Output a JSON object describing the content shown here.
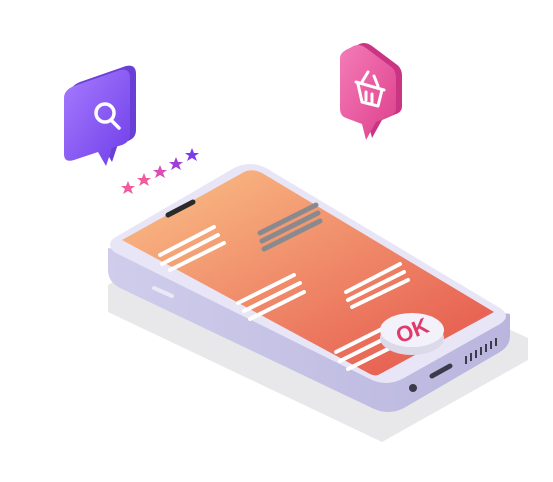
{
  "illustration": {
    "ok_button_label": "OK",
    "rating_stars": 5,
    "icons": {
      "search_bubble": "magnifier-icon",
      "shop_bubble": "basket-icon"
    },
    "colors": {
      "screen_gradient_start": "#fbc288",
      "screen_gradient_end": "#e4524a",
      "phone_body": "#c9c6e6",
      "phone_frame": "#e6e4f5",
      "search_bubble": "#8b5cf6",
      "shop_bubble": "#ec5ba3",
      "star_pink": "#f25aa0",
      "star_purple": "#7c3aed",
      "shadow": "#e6e6e8"
    }
  }
}
